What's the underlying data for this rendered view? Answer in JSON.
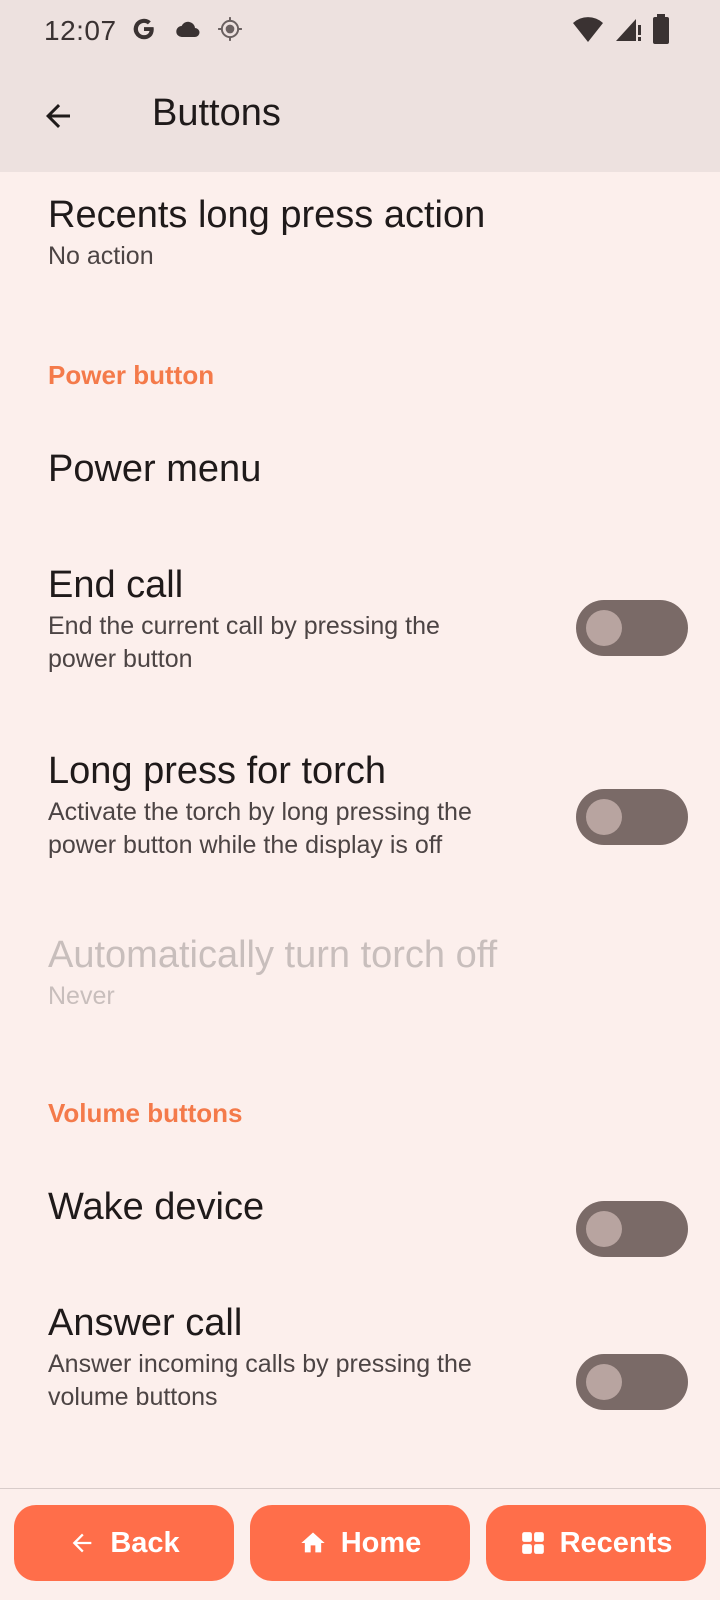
{
  "status_bar": {
    "time": "12:07",
    "icons": [
      "google-icon",
      "cloud-icon",
      "location-icon",
      "wifi-icon",
      "signal-icon",
      "battery-icon"
    ]
  },
  "app_bar": {
    "title": "Buttons"
  },
  "items": {
    "recents_long_press": {
      "title": "Recents long press action",
      "summary": "No action"
    },
    "power_category": "Power button",
    "power_menu": {
      "title": "Power menu"
    },
    "end_call": {
      "title": "End call",
      "summary": "End the current call by pressing the power button",
      "enabled": false
    },
    "long_press_torch": {
      "title": "Long press for torch",
      "summary": "Activate the torch by long pressing the power button while the display is off",
      "enabled": false
    },
    "auto_torch_off": {
      "title": "Automatically turn torch off",
      "summary": "Never"
    },
    "volume_category": "Volume buttons",
    "wake_device": {
      "title": "Wake device",
      "enabled": false
    },
    "answer_call": {
      "title": "Answer call",
      "summary": "Answer incoming calls by pressing the volume buttons",
      "enabled": false
    }
  },
  "nav": {
    "back_label": "Back",
    "home_label": "Home",
    "recents_label": "Recents"
  },
  "colors": {
    "accent": "#FF6E4A",
    "category": "#F47A4A",
    "background": "#FCEFEC",
    "app_bar": "#EDE1DF",
    "switch_track_off": "#7A6A67"
  }
}
